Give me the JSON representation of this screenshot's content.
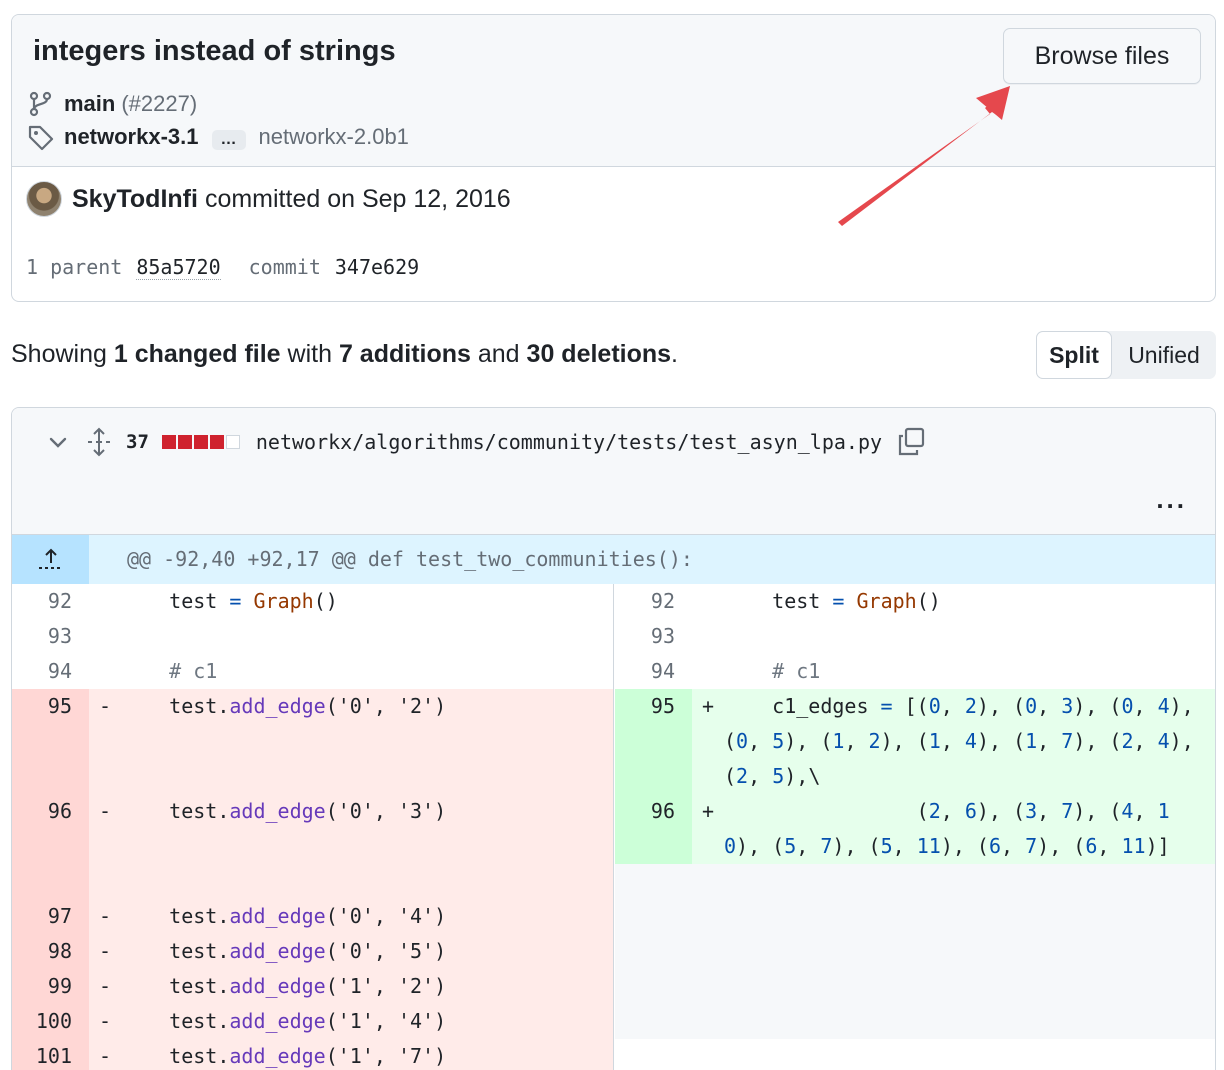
{
  "commit": {
    "title": "integers instead of strings",
    "browse_label": "Browse files",
    "branch": "main",
    "pr_ref": "(#2227)",
    "tag_latest": "networkx-3.1",
    "tag_ellipsis": "…",
    "tag_oldest": "networkx-2.0b1",
    "author": "SkyTodInfi",
    "committed_text": "committed on Sep 12, 2016",
    "parent_label": "1 parent",
    "parent_sha": "85a5720",
    "commit_label": "commit",
    "commit_sha": "347e629"
  },
  "summary": {
    "showing": "Showing",
    "changed_files": "1 changed file",
    "with": "with",
    "additions": "7 additions",
    "and": "and",
    "deletions": "30 deletions",
    "period": "."
  },
  "view_toggle": {
    "split_label": "Split",
    "unified_label": "Unified"
  },
  "file": {
    "change_count": "37",
    "path": "networkx/algorithms/community/tests/test_asyn_lpa.py",
    "more": "..."
  },
  "hunk_header": "@@ -92,40 +92,17 @@ def test_two_communities():",
  "left_lines": [
    {
      "num": "92",
      "sign": "",
      "code": "    test = Graph()"
    },
    {
      "num": "93",
      "sign": "",
      "code": ""
    },
    {
      "num": "94",
      "sign": "",
      "code": "    # c1"
    },
    {
      "num": "95",
      "sign": "-",
      "code": "    test.add_edge('0', '2')"
    },
    {
      "num": "96",
      "sign": "-",
      "code": "    test.add_edge('0', '3')"
    },
    {
      "num": "97",
      "sign": "-",
      "code": "    test.add_edge('0', '4')"
    },
    {
      "num": "98",
      "sign": "-",
      "code": "    test.add_edge('0', '5')"
    },
    {
      "num": "99",
      "sign": "-",
      "code": "    test.add_edge('1', '2')"
    },
    {
      "num": "100",
      "sign": "-",
      "code": "    test.add_edge('1', '4')"
    },
    {
      "num": "101",
      "sign": "-",
      "code": "    test.add_edge('1', '7')"
    }
  ],
  "right_lines": [
    {
      "num": "92",
      "sign": "",
      "code": "    test = Graph()"
    },
    {
      "num": "93",
      "sign": "",
      "code": ""
    },
    {
      "num": "94",
      "sign": "",
      "code": "    # c1"
    },
    {
      "num": "95",
      "sign": "+",
      "code": "    c1_edges = [(0, 2), (0, 3), (0, 4), (0, 5), (1, 2), (1, 4), (1, 7), (2, 4), (2, 5),\\"
    },
    {
      "num": "96",
      "sign": "+",
      "code": "                (2, 6), (3, 7), (4, 10), (5, 7), (5, 11), (6, 7), (6, 11)]"
    }
  ],
  "colors": {
    "del_bg": "#ffebe9",
    "del_num_bg": "#ffd7d5",
    "add_bg": "#e6ffec",
    "add_num_bg": "#ccffd8",
    "hunk_bg": "#ddf4ff",
    "diffstat_red": "#cf222e",
    "arrow": "#e5484d"
  },
  "icons": [
    "git-branch-icon",
    "tag-icon",
    "chevron-down-icon",
    "expand-icon",
    "copy-icon",
    "kebab-icon",
    "expand-up-icon"
  ]
}
